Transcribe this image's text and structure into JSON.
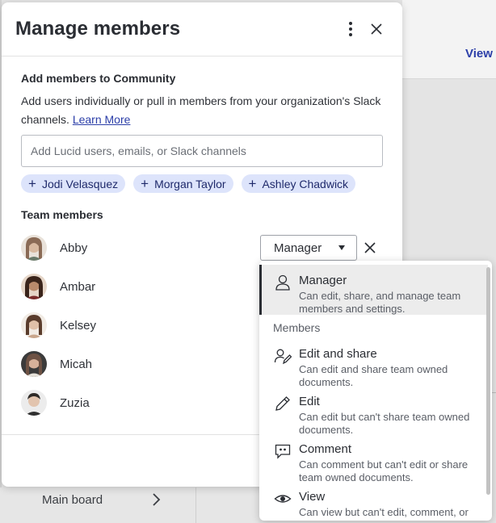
{
  "background": {
    "top_right_link": "View",
    "bottom_item": "Main board"
  },
  "modal": {
    "title": "Manage members",
    "add_section": {
      "title": "Add members to Community",
      "description": "Add users individually or pull in members from your organization's Slack channels.",
      "learn_more": "Learn More",
      "search_placeholder": "Add Lucid users, emails, or Slack channels",
      "suggestions": [
        "Jodi Velasquez",
        "Morgan Taylor",
        "Ashley Chadwick"
      ]
    },
    "team_section": {
      "title": "Team members",
      "members": [
        {
          "name": "Abby",
          "avatar_color": "#8a6a55"
        },
        {
          "name": "Ambar",
          "avatar_color": "#5a3a2e"
        },
        {
          "name": "Kelsey",
          "avatar_color": "#c9a68c"
        },
        {
          "name": "Micah",
          "avatar_color": "#6e5244"
        },
        {
          "name": "Zuzia",
          "avatar_color": "#3b3b3b"
        }
      ],
      "selected_role": "Manager"
    }
  },
  "role_dropdown": {
    "group_label": "Members",
    "options": [
      {
        "icon": "person-icon",
        "title": "Manager",
        "description": "Can edit, share, and manage team members and settings.",
        "selected": true
      },
      {
        "icon": "edit-share-icon",
        "title": "Edit and share",
        "description": "Can edit and share team owned documents.",
        "selected": false
      },
      {
        "icon": "pencil-icon",
        "title": "Edit",
        "description": "Can edit but can't share team owned documents.",
        "selected": false
      },
      {
        "icon": "comment-icon",
        "title": "Comment",
        "description": "Can comment but can't edit or share team owned documents.",
        "selected": false
      },
      {
        "icon": "eye-icon",
        "title": "View",
        "description": "Can view but can't edit, comment, or",
        "selected": false
      }
    ]
  },
  "colors": {
    "link": "#2b3ea8",
    "chip_bg": "#dde4fb",
    "selected_bg": "#ececec"
  }
}
